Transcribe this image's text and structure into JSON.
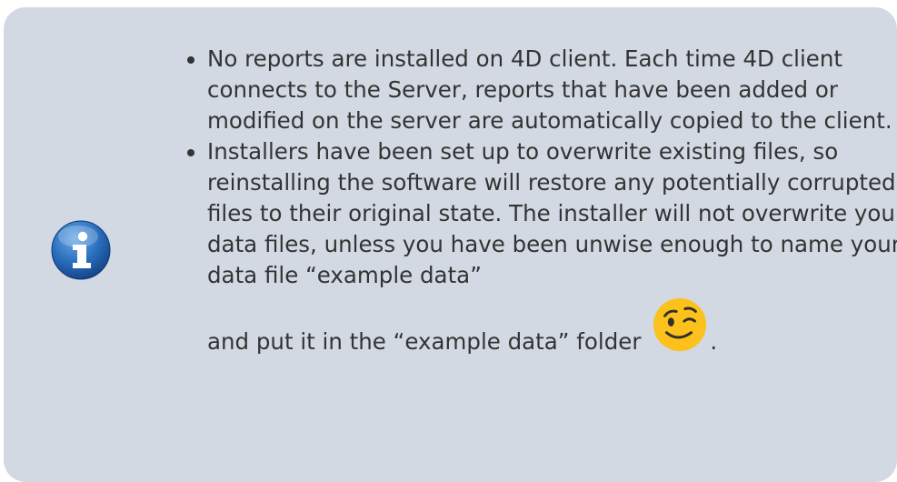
{
  "note": {
    "icon": "info-icon",
    "items": [
      {
        "text": "No reports are installed on 4D client. Each time 4D client connects to the Server, reports that have been added or modified on the server are automatically copied to the client."
      },
      {
        "text": "Installers have been set up to overwrite existing files, so reinstalling the software will restore any potentially corrupted files to their original state. The installer will not overwrite your data files, unless you have been unwise enough to name your data file “example data”",
        "text_end": "and put it in the “example data” folder",
        "emoji": "winking-face-emoji",
        "trailing": "."
      }
    ]
  },
  "colors": {
    "box_background": "#d3d9e3",
    "text": "#333333",
    "icon_blue": "#1f63ad",
    "emoji_yellow": "#fcc21b"
  }
}
